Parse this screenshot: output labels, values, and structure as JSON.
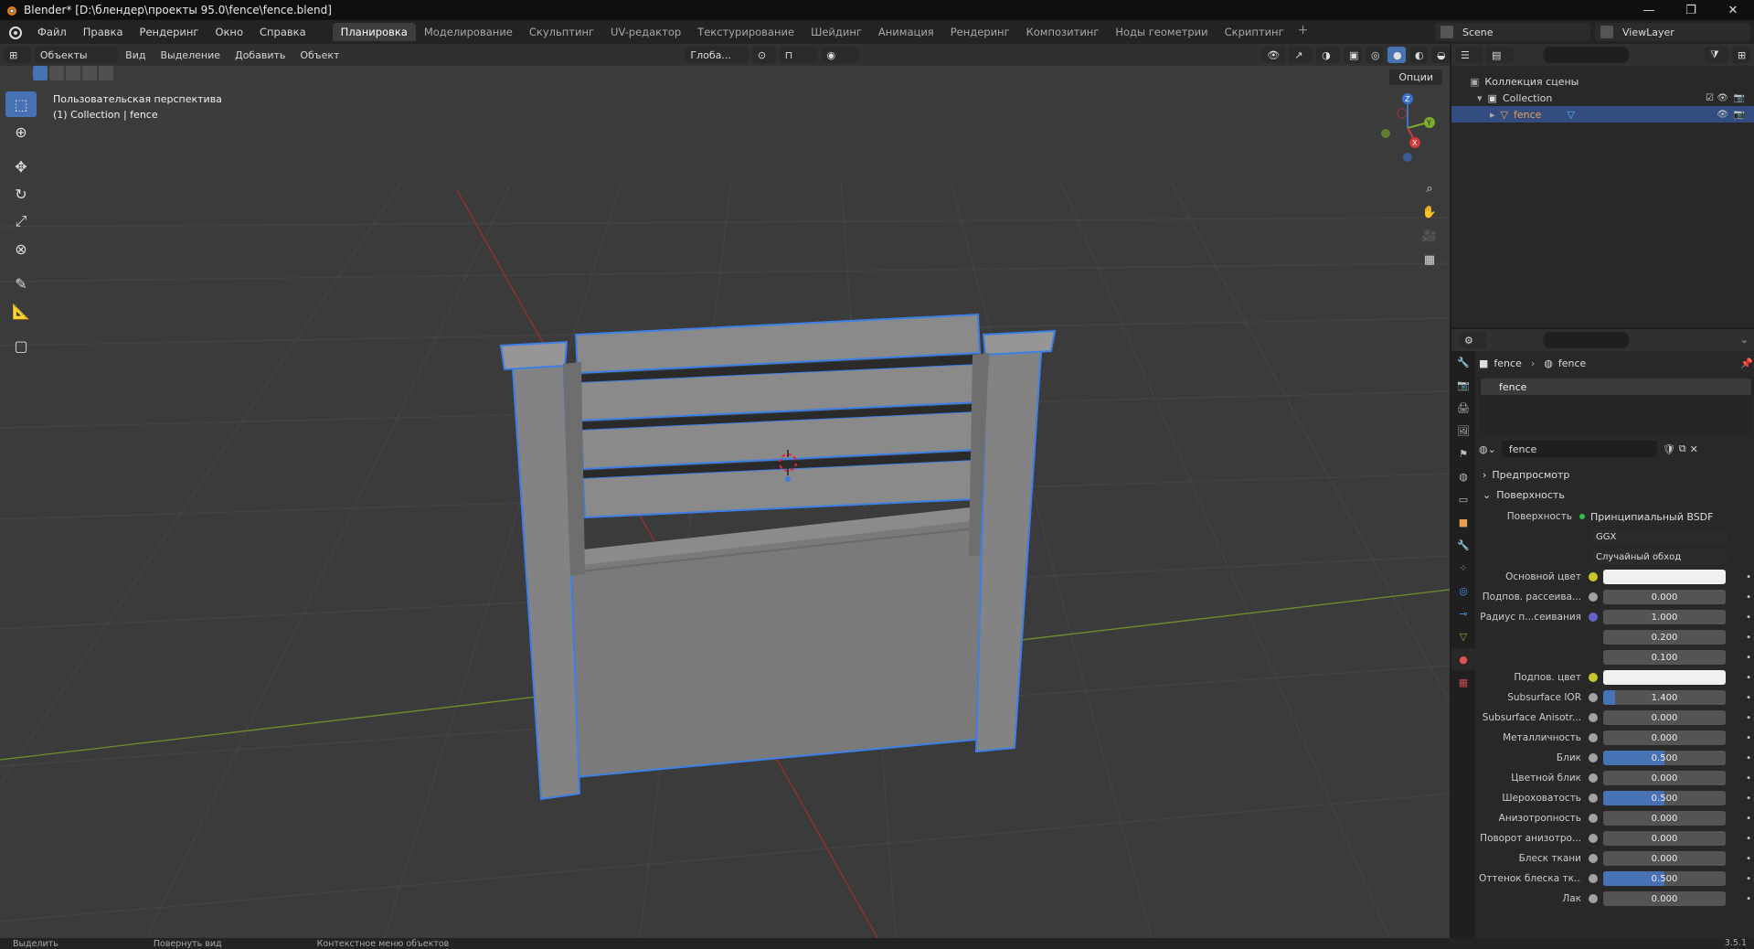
{
  "window": {
    "title": "Blender* [D:\\блендер\\проекты 95.0\\fence\\fence.blend]",
    "minimize": "—",
    "maximize": "❐",
    "close": "✕"
  },
  "menu": [
    "Файл",
    "Правка",
    "Рендеринг",
    "Окно",
    "Справка"
  ],
  "workspaces": [
    "Планировка",
    "Моделирование",
    "Скульптинг",
    "UV-редактор",
    "Текстурирование",
    "Шейдинг",
    "Анимация",
    "Рендеринг",
    "Композитинг",
    "Ноды геометрии",
    "Скриптинг"
  ],
  "workspace_plus": "+",
  "scene": "Scene",
  "view_layer": "ViewLayer",
  "viewport_header": {
    "mode": "Объекты",
    "menus": [
      "Вид",
      "Выделение",
      "Добавить",
      "Объект"
    ],
    "transform_orientation": "Глоба...",
    "options": "Опции"
  },
  "viewport_info": {
    "line1": "Пользовательская перспектива",
    "line2": "(1) Collection | fence"
  },
  "gizmo": {
    "x": "X",
    "y": "Y",
    "z": "Z"
  },
  "outliner": {
    "scene_collection": "Коллекция сцены",
    "collection": "Collection",
    "object": "fence"
  },
  "properties": {
    "breadcrumb_object": "fence",
    "breadcrumb_material": "fence",
    "slot_name": "fence",
    "material_name": "fence",
    "panels": {
      "preview": "Предпросмотр",
      "surface": "Поверхность"
    },
    "surface_label": "Поверхность",
    "surface_value": "Принципиальный BSDF",
    "distribution": "GGX",
    "subsurface_method": "Случайный обход",
    "rows": [
      {
        "label": "Основной цвет",
        "value": "",
        "type": "color",
        "sock": "yellow"
      },
      {
        "label": "Подпов. рассеива...",
        "value": "0.000",
        "fill": 0,
        "sock": "grey"
      },
      {
        "label": "Радиус п...сеивания",
        "value": "1.000",
        "fill": 0,
        "sock": "purple"
      },
      {
        "label": "",
        "value": "0.200",
        "fill": 0,
        "sock": "none"
      },
      {
        "label": "",
        "value": "0.100",
        "fill": 0,
        "sock": "none"
      },
      {
        "label": "Подпов. цвет",
        "value": "",
        "type": "color",
        "sock": "yellow"
      },
      {
        "label": "Subsurface IOR",
        "value": "1.400",
        "fill": 0.1,
        "sock": "grey"
      },
      {
        "label": "Subsurface Anisotr...",
        "value": "0.000",
        "fill": 0,
        "sock": "grey"
      },
      {
        "label": "Металличность",
        "value": "0.000",
        "fill": 0,
        "sock": "grey"
      },
      {
        "label": "Блик",
        "value": "0.500",
        "fill": 0.5,
        "sock": "grey"
      },
      {
        "label": "Цветной блик",
        "value": "0.000",
        "fill": 0,
        "sock": "grey"
      },
      {
        "label": "Шероховатость",
        "value": "0.500",
        "fill": 0.5,
        "sock": "grey"
      },
      {
        "label": "Анизотропность",
        "value": "0.000",
        "fill": 0,
        "sock": "grey"
      },
      {
        "label": "Поворот анизотро...",
        "value": "0.000",
        "fill": 0,
        "sock": "grey"
      },
      {
        "label": "Блеск ткани",
        "value": "0.000",
        "fill": 0,
        "sock": "grey"
      },
      {
        "label": "Оттенок блеска тк...",
        "value": "0.500",
        "fill": 0.5,
        "sock": "grey"
      },
      {
        "label": "Лак",
        "value": "0.000",
        "fill": 0,
        "sock": "grey"
      }
    ]
  },
  "status": {
    "select": "Выделить",
    "rotate": "Повернуть вид",
    "context": "Контекстное меню объектов",
    "version": "3.5.1"
  },
  "colors": {
    "accent": "#4772b3",
    "selection_outline": "#3d7fe6",
    "x_axis": "#d03a3a",
    "y_axis": "#7aab2a",
    "z_axis": "#3a72d0"
  }
}
